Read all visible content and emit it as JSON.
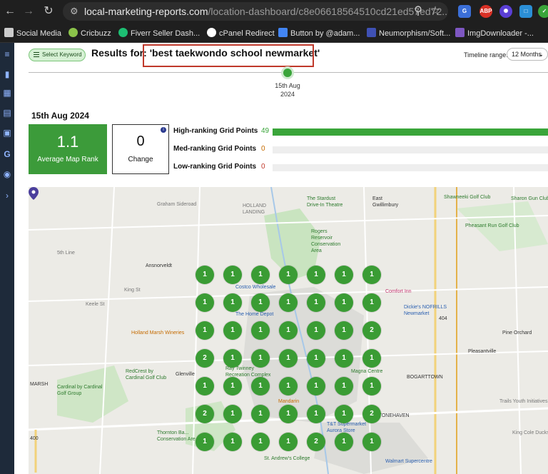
{
  "browser": {
    "url_host": "local-marketing-reports.com",
    "url_path": "/location-dashboard/c8e06618564510cd21ed57ed72..."
  },
  "bookmarks": [
    {
      "label": "Social Media",
      "color": "#cccccc"
    },
    {
      "label": "Cricbuzz",
      "color": "#8bc34a"
    },
    {
      "label": "Fiverr Seller Dash...",
      "color": "#1dbf73"
    },
    {
      "label": "cPanel Redirect",
      "color": "#ffffff"
    },
    {
      "label": "Button by @adam...",
      "color": "#4285f4"
    },
    {
      "label": "Neumorphism/Soft...",
      "color": "#3f51b5"
    },
    {
      "label": "ImgDownloader -...",
      "color": "#7e57c2"
    }
  ],
  "header": {
    "select_keyword": "Select Keyword",
    "results_prefix": "Results for:",
    "keyword": "'best taekwondo school newmarket'",
    "timeline_label": "Timeline range:",
    "timeline_value": "12 Months",
    "timeline_date_line1": "15th Aug",
    "timeline_date_line2": "2024"
  },
  "summary": {
    "date_heading": "15th Aug 2024",
    "avg_rank_value": "1.1",
    "avg_rank_label": "Average Map Rank",
    "change_value": "0",
    "change_label": "Change",
    "rows": [
      {
        "label": "High-ranking Grid Points",
        "value": "49",
        "fraction": 1.0,
        "color": "#3aa53a"
      },
      {
        "label": "Med-ranking Grid Points",
        "value": "0",
        "fraction": 0.0,
        "color": "#c56b00"
      },
      {
        "label": "Low-ranking Grid Points",
        "value": "0",
        "fraction": 0.0,
        "color": "#c0392b"
      }
    ]
  },
  "map": {
    "grid_ranks": [
      [
        "1",
        "1",
        "1",
        "1",
        "1",
        "1",
        "1"
      ],
      [
        "1",
        "1",
        "1",
        "1",
        "1",
        "1",
        "1"
      ],
      [
        "1",
        "1",
        "1",
        "1",
        "1",
        "1",
        "2"
      ],
      [
        "2",
        "1",
        "1",
        "1",
        "1",
        "1",
        "1"
      ],
      [
        "1",
        "1",
        "1",
        "1",
        "1",
        "1",
        "1"
      ],
      [
        "2",
        "1",
        "1",
        "1",
        "1",
        "1",
        "2"
      ],
      [
        "1",
        "1",
        "1",
        "1",
        "2",
        "1",
        "1"
      ]
    ],
    "places": {
      "holland_landing": "HOLLAND\nLANDING",
      "stardust": "The Stardust\nDrive-In Theatre",
      "east_gwillimbury": "East\nGwillimbury",
      "shawneeki": "Shawneeki Golf Club",
      "sharon": "Sharon Gun Club",
      "pheasant": "Pheasant Run Golf Club",
      "rogers": "Rogers\nReservoir\nConservation\nArea",
      "ansnorveldt": "Ansnorveldt",
      "costco": "Costco Wholesale",
      "comfort": "Comfort Inn",
      "dickies": "Dickie's NOFRILLS\nNewmarket",
      "home_depot": "The Home Depot",
      "holland_marsh": "Holland Marsh Wineries",
      "pine_orchard": "Pine Orchard",
      "pleasantville": "Pleasantville",
      "glenville": "Glenville",
      "ray_twinney": "Ray Twinney\nRecreation Complex",
      "magna": "Magna Centre",
      "bogarttown": "BOGARTTOWN",
      "redcrest": "RedCrest by\nCardinal Golf Club",
      "cardinal": "Cardinal by Cardinal\nGolf Group",
      "marsh": "MARSH",
      "mandarin": "Mandarin",
      "stonehaven": "STONEHAVEN",
      "thornton": "Thornton Ba...\nConservation Are...",
      "tt": "T&T Supermarket\nAurora Store",
      "trails_youth": "Trails Youth Initiatives",
      "king_cole": "King Cole Ducks",
      "st_andrews": "St. Andrew's College",
      "walmart": "Walmart Supercentre",
      "route_404": "404",
      "route_400": "400",
      "road_graham": "Graham Sideroad",
      "road_5th": "5th Line",
      "road_king": "King St",
      "road_keele": "Keele St"
    }
  },
  "colors": {
    "accent_green": "#3aa53a",
    "highlight_red": "#c0392b"
  }
}
